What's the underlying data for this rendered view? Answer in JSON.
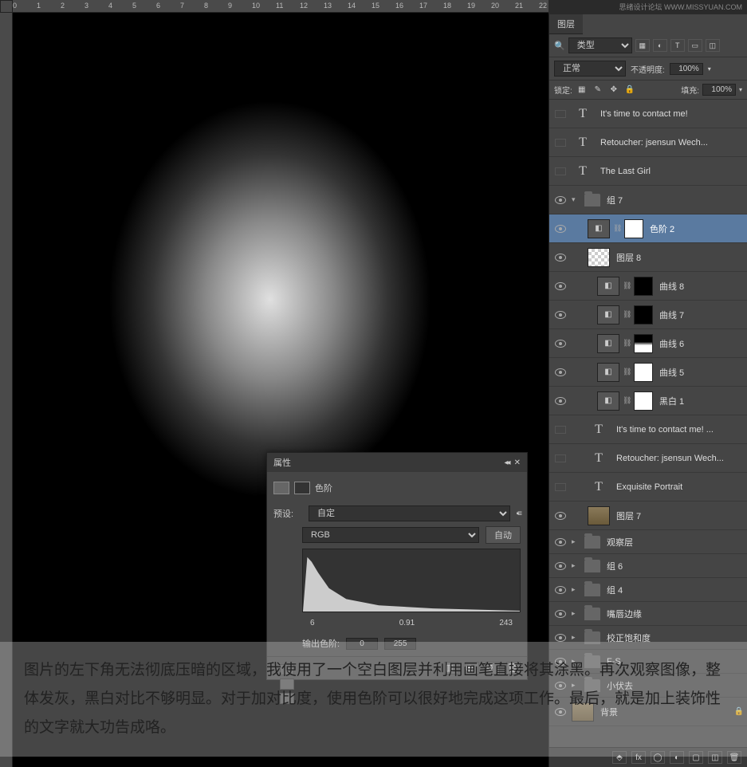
{
  "watermark": "思绪设计论坛  WWW.MISSYUAN.COM",
  "ruler_ticks": [
    "0",
    "1",
    "2",
    "3",
    "4",
    "5",
    "6",
    "7",
    "8",
    "9",
    "10",
    "11",
    "12",
    "13",
    "14",
    "15",
    "16",
    "17",
    "18",
    "19",
    "20",
    "21",
    "22"
  ],
  "layers_panel": {
    "tab": "图层",
    "filter_label": "类型",
    "blend_mode": "正常",
    "opacity_label": "不透明度:",
    "opacity_value": "100%",
    "lock_label": "锁定:",
    "fill_label": "填充:",
    "fill_value": "100%",
    "layers": [
      {
        "vis": false,
        "type": "text",
        "name": "It's time to contact me!",
        "indent": 0
      },
      {
        "vis": false,
        "type": "text",
        "name": "Retoucher: jsensun Wech...",
        "indent": 0
      },
      {
        "vis": false,
        "type": "text",
        "name": "The Last Girl",
        "indent": 0
      },
      {
        "vis": true,
        "type": "folder",
        "name": "组 7",
        "indent": 0,
        "expanded": true
      },
      {
        "vis": true,
        "type": "adj",
        "name": "色阶 2",
        "indent": 1,
        "mask": "white",
        "link": true,
        "selected": true
      },
      {
        "vis": true,
        "type": "trans",
        "name": "图层 8",
        "indent": 1
      },
      {
        "vis": true,
        "type": "adj",
        "name": "曲线 8",
        "indent": 2,
        "mask": "dark",
        "link": true
      },
      {
        "vis": true,
        "type": "adj",
        "name": "曲线 7",
        "indent": 2,
        "mask": "dark",
        "link": true
      },
      {
        "vis": true,
        "type": "adj",
        "name": "曲线 6",
        "indent": 2,
        "mask": "mixed",
        "link": true
      },
      {
        "vis": true,
        "type": "adj",
        "name": "曲线 5",
        "indent": 2,
        "mask": "white",
        "link": true
      },
      {
        "vis": true,
        "type": "adj",
        "name": "黑白 1",
        "indent": 2,
        "mask": "white",
        "link": true
      },
      {
        "vis": false,
        "type": "text",
        "name": "It's time to contact me! ...",
        "indent": 1
      },
      {
        "vis": false,
        "type": "text",
        "name": "Retoucher: jsensun Wech...",
        "indent": 1
      },
      {
        "vis": false,
        "type": "text",
        "name": "Exquisite Portrait",
        "indent": 1
      },
      {
        "vis": true,
        "type": "img",
        "name": "图层 7",
        "indent": 1
      },
      {
        "vis": true,
        "type": "folder",
        "name": "观察层",
        "indent": 0
      },
      {
        "vis": true,
        "type": "folder",
        "name": "组 6",
        "indent": 0
      },
      {
        "vis": true,
        "type": "folder",
        "name": "组 4",
        "indent": 0
      },
      {
        "vis": true,
        "type": "folder",
        "name": "嘴唇边缘",
        "indent": 0
      },
      {
        "vis": true,
        "type": "folder",
        "name": "校正饱和度",
        "indent": 0
      },
      {
        "vis": true,
        "type": "folder",
        "name": "F-S",
        "indent": 0
      },
      {
        "vis": true,
        "type": "folder",
        "name": "小伏去",
        "indent": 0
      },
      {
        "vis": true,
        "type": "img",
        "name": "背景",
        "indent": 0,
        "locked": true
      }
    ]
  },
  "properties": {
    "header": "属性",
    "title": "色阶",
    "preset_label": "预设:",
    "preset_value": "自定",
    "channel": "RGB",
    "auto_btn": "自动",
    "input_shadows": "6",
    "input_mid": "0.91",
    "input_highlights": "243",
    "output_label": "输出色阶:",
    "output_low": "0",
    "output_high": "255"
  },
  "overlay": "图片的左下角无法彻底压暗的区域，我使用了一个空白图层并利用画笔直接将其涂黑。再次观察图像，整体发灰，黑白对比不够明显。对于加对比度，使用色阶可以很好地完成这项工作。最后，就是加上装饰性的文字就大功告成咯。"
}
